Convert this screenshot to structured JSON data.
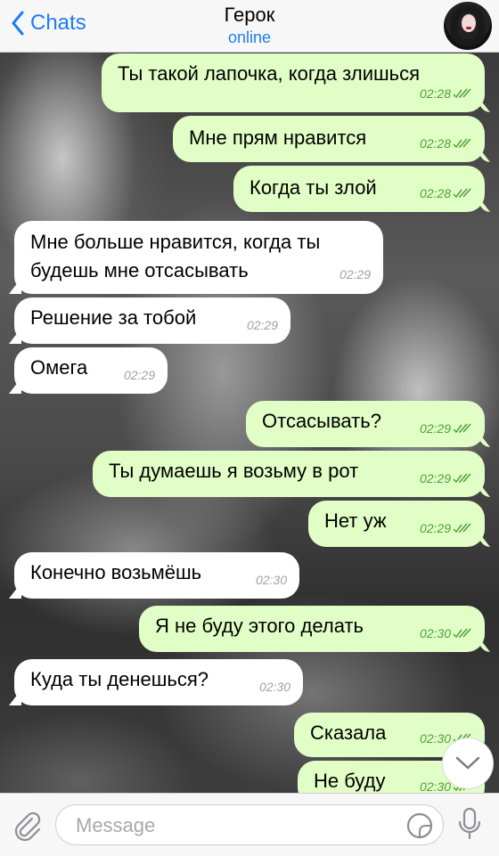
{
  "header": {
    "back_label": "Chats",
    "title": "Герок",
    "status": "online"
  },
  "messages": [
    {
      "dir": "out",
      "text": "Ты такой лапочка, когда злишься",
      "time": "02:28"
    },
    {
      "dir": "out",
      "text": "Мне прям нравится",
      "time": "02:28"
    },
    {
      "dir": "out",
      "text": "Когда ты злой",
      "time": "02:28"
    },
    {
      "dir": "in",
      "text": "Мне больше нравится, когда ты будешь мне отсасывать",
      "time": "02:29"
    },
    {
      "dir": "in",
      "text": "Решение за тобой",
      "time": "02:29"
    },
    {
      "dir": "in",
      "text": "Омега",
      "time": "02:29"
    },
    {
      "dir": "out",
      "text": "Отсасывать?",
      "time": "02:29"
    },
    {
      "dir": "out",
      "text": "Ты думаешь я возьму в рот",
      "time": "02:29"
    },
    {
      "dir": "out",
      "text": "Нет уж",
      "time": "02:29"
    },
    {
      "dir": "in",
      "text": "Конечно возьмёшь",
      "time": "02:30"
    },
    {
      "dir": "out",
      "text": "Я не буду этого делать",
      "time": "02:30"
    },
    {
      "dir": "in",
      "text": "Куда ты денешься?",
      "time": "02:30"
    },
    {
      "dir": "out",
      "text": "Сказала",
      "time": "02:30"
    },
    {
      "dir": "out",
      "text": "Не буду",
      "time": "02:30"
    }
  ],
  "input": {
    "placeholder": "Message"
  },
  "colors": {
    "accent": "#1e7cf2",
    "outgoing_bubble": "#e1fec6",
    "incoming_bubble": "#ffffff",
    "outgoing_time": "#4da138"
  },
  "icons": {
    "back": "chevron-left-icon",
    "attach": "paperclip-icon",
    "sticker": "sticker-icon",
    "mic": "microphone-icon",
    "scroll": "chevron-down-icon",
    "read": "double-check-icon"
  }
}
